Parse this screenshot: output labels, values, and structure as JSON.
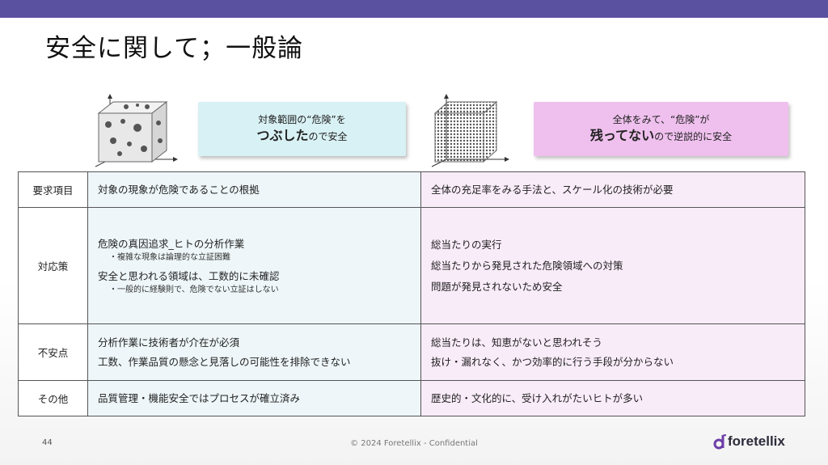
{
  "colors": {
    "topbar": "#5b51a1",
    "left_box": "#d8f1f4",
    "right_box": "#efc0ee",
    "left_col": "#eef6f9",
    "right_col": "#f9ecf9",
    "logo_accent": "#6d3fa8"
  },
  "title": "安全に関して；一般論",
  "left_box": {
    "line1": "対象範囲の“危険”を",
    "line2_bold": "つぶした",
    "line2_rest": "ので安全"
  },
  "right_box": {
    "line1": "全体をみて、“危険”が",
    "line2_bold": "残ってない",
    "line2_rest": "ので逆説的に安全"
  },
  "table": {
    "rows": [
      {
        "header": "要求項目",
        "left": [
          "対象の現象が危険であることの根拠"
        ],
        "right": [
          "全体の充足率をみる手法と、スケール化の技術が必要"
        ]
      },
      {
        "header": "対応策",
        "left_main1": "危険の真因追求_ヒトの分析作業",
        "left_sub1": "・複雑な現象は論理的な立証困難",
        "left_main2": "安全と思われる領域は、工数的に未確認",
        "left_sub2": "・一般的に経験則で、危険でない立証はしない",
        "right": [
          "総当たりの実行",
          "総当たりから発見された危険領域への対策",
          "問題が発見されないため安全"
        ]
      },
      {
        "header": "不安点",
        "left": [
          "分析作業に技術者が介在が必須",
          "工数、作業品質の懸念と見落しの可能性を排除できない"
        ],
        "right": [
          "総当たりは、知恵がないと思われそう",
          "抜け・漏れなく、かつ効率的に行う手段が分からない"
        ]
      },
      {
        "header": "その他",
        "left": [
          "品質管理・機能安全ではプロセスが確立済み"
        ],
        "right": [
          "歴史的・文化的に、受け入れがたいヒトが多い"
        ]
      }
    ]
  },
  "footer": {
    "page": "44",
    "copyright": "© 2024 Foretellix - Confidential",
    "logo_text": "foretellix"
  },
  "icons": [
    "sparse-cube-icon",
    "dense-cube-icon",
    "foretellix-logo-icon"
  ]
}
